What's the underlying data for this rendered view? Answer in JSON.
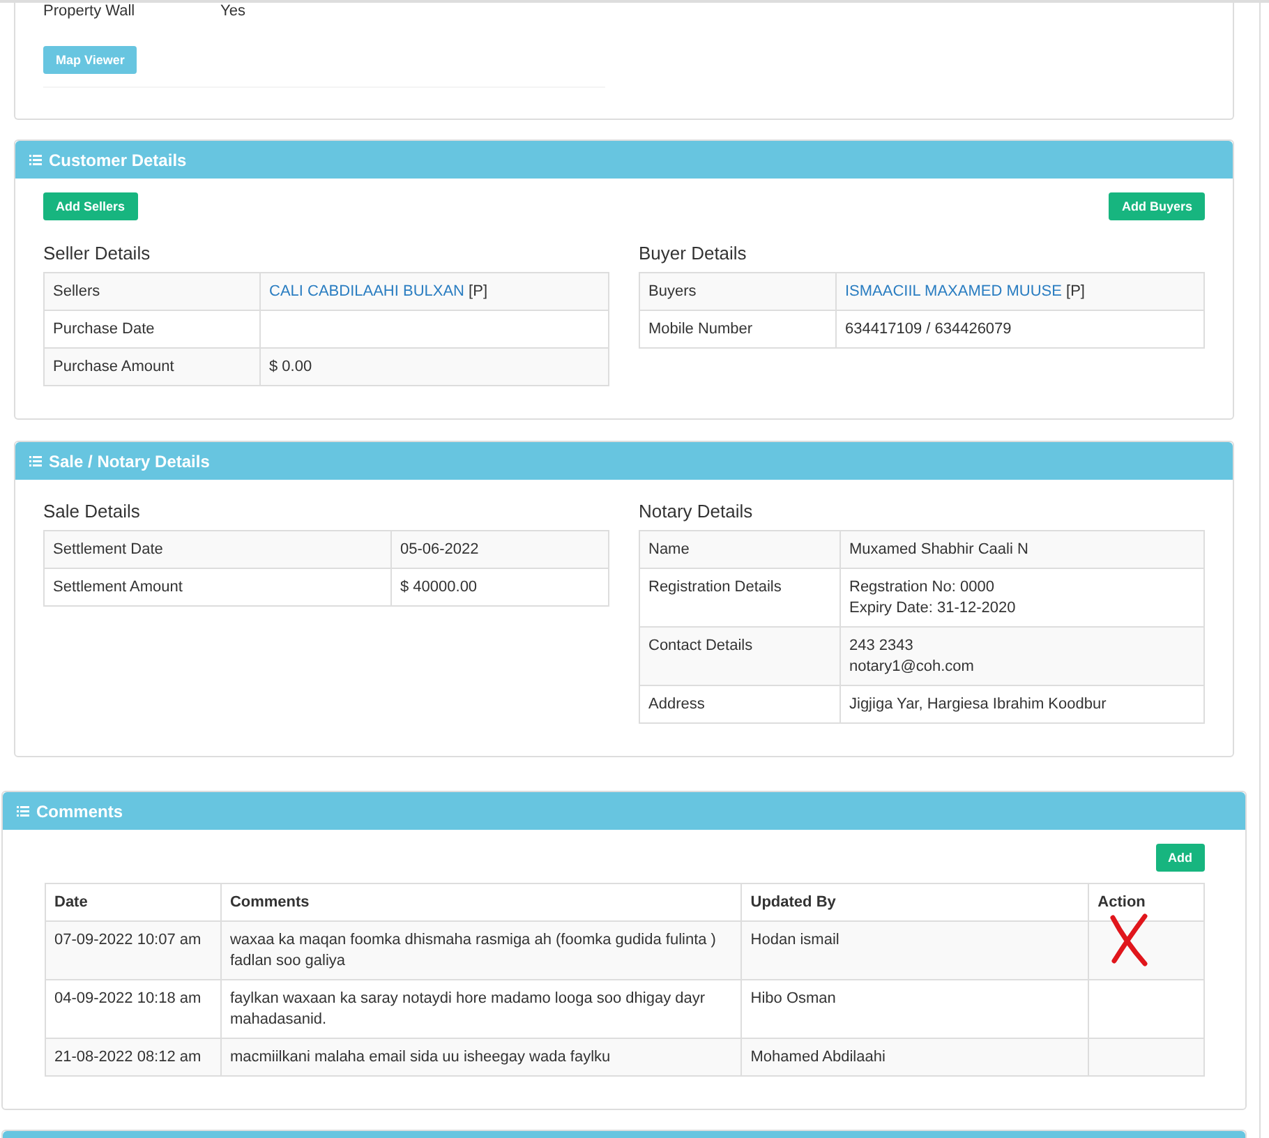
{
  "property_panel": {
    "rows": [
      {
        "label": "Property Wall",
        "value": "Yes"
      }
    ],
    "button": "Map Viewer"
  },
  "customer_panel": {
    "title": "Customer Details",
    "left_button": "Add Sellers",
    "right_button": "Add Buyers",
    "seller": {
      "title": "Seller Details",
      "rows": [
        {
          "label": "Sellers",
          "link": "CALI CABDILAAHI BULXAN",
          "suffix": " [P]"
        },
        {
          "label": "Purchase Date"
        },
        {
          "label": "Purchase Amount",
          "value": "$ 0.00"
        }
      ]
    },
    "buyer": {
      "title": "Buyer Details",
      "rows": [
        {
          "label": "Buyers",
          "link": "ISMAACIIL MAXAMED MUUSE",
          "suffix": " [P]"
        },
        {
          "label": "Mobile Number",
          "value": "634417109 / 634426079"
        }
      ]
    }
  },
  "sale_panel": {
    "title": "Sale / Notary Details",
    "sale": {
      "title": "Sale Details",
      "rows": [
        {
          "label": "Settlement Date",
          "value": "05-06-2022"
        },
        {
          "label": "Settlement Amount",
          "value": "$ 40000.00"
        }
      ]
    },
    "notary": {
      "title": "Notary Details",
      "rows": [
        {
          "label": "Name",
          "lines": [
            "Muxamed Shabhir Caali N"
          ]
        },
        {
          "label": "Registration Details",
          "lines": [
            "Regstration No: 0000",
            "Expiry Date: 31-12-2020"
          ]
        },
        {
          "label": "Contact Details",
          "lines": [
            "243 2343",
            "notary1@coh.com"
          ]
        },
        {
          "label": "Address",
          "lines": [
            "Jigjiga Yar, Hargiesa Ibrahim Koodbur"
          ]
        }
      ]
    }
  },
  "comments_panel": {
    "title": "Comments",
    "button": "Add",
    "columns": [
      "Date",
      "Comments",
      "Updated By",
      "Action"
    ],
    "rows": [
      {
        "date": "07-09-2022 10:07 am",
        "comment": "waxaa ka maqan foomka dhismaha rasmiga ah (foomka gudida fulinta ) fadlan soo galiya",
        "updated_by": "Hodan ismail",
        "crossed": true
      },
      {
        "date": "04-09-2022 10:18 am",
        "comment": "faylkan waxaan ka saray notaydi hore madamo looga soo dhigay dayr mahadasanid.",
        "updated_by": "Hibo Osman",
        "crossed": false
      },
      {
        "date": "21-08-2022 08:12 am",
        "comment": "macmiilkani malaha email sida uu isheegay wada faylku",
        "updated_by": "Mohamed Abdilaahi",
        "crossed": false
      }
    ]
  }
}
